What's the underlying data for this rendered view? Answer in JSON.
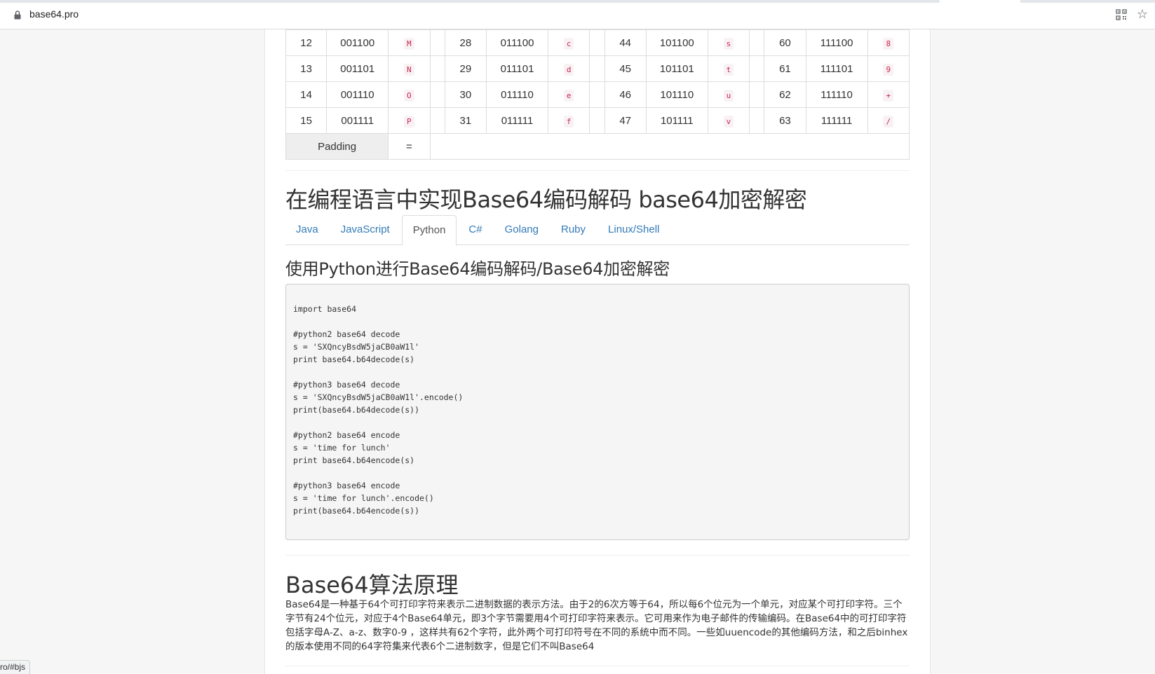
{
  "browser": {
    "url": "base64.pro",
    "status_url": "ro/#bjs"
  },
  "table": {
    "rows": [
      [
        [
          "12",
          "001100",
          "M"
        ],
        [
          "28",
          "011100",
          "c"
        ],
        [
          "44",
          "101100",
          "s"
        ],
        [
          "60",
          "111100",
          "8"
        ]
      ],
      [
        [
          "13",
          "001101",
          "N"
        ],
        [
          "29",
          "011101",
          "d"
        ],
        [
          "45",
          "101101",
          "t"
        ],
        [
          "61",
          "111101",
          "9"
        ]
      ],
      [
        [
          "14",
          "001110",
          "O"
        ],
        [
          "30",
          "011110",
          "e"
        ],
        [
          "46",
          "101110",
          "u"
        ],
        [
          "62",
          "111110",
          "+"
        ]
      ],
      [
        [
          "15",
          "001111",
          "P"
        ],
        [
          "31",
          "011111",
          "f"
        ],
        [
          "47",
          "101111",
          "v"
        ],
        [
          "63",
          "111111",
          "/"
        ]
      ]
    ],
    "padding_label": "Padding",
    "padding_value": "="
  },
  "main_heading": "在编程语言中实现Base64编码解码 base64加密解密",
  "tabs": [
    {
      "label": "Java",
      "active": false
    },
    {
      "label": "JavaScript",
      "active": false
    },
    {
      "label": "Python",
      "active": true
    },
    {
      "label": "C#",
      "active": false
    },
    {
      "label": "Golang",
      "active": false
    },
    {
      "label": "Ruby",
      "active": false
    },
    {
      "label": "Linux/Shell",
      "active": false
    }
  ],
  "sub_heading": "使用Python进行Base64编码解码/Base64加密解密",
  "code": "import base64\n\n#python2 base64 decode\ns = 'SXQncyBsdW5jaCB0aW1l'\nprint base64.b64decode(s)\n\n#python3 base64 decode\ns = 'SXQncyBsdW5jaCB0aW1l'.encode()\nprint(base64.b64decode(s))\n\n#python2 base64 encode\ns = 'time for lunch'\nprint base64.b64encode(s)\n\n#python3 base64 encode\ns = 'time for lunch'.encode()\nprint(base64.b64encode(s))",
  "algo_heading": "Base64算法原理",
  "algo_text": "Base64是一种基于64个可打印字符来表示二进制数据的表示方法。由于2的6次方等于64，所以每6个位元为一个单元，对应某个可打印字符。三个字节有24个位元，对应于4个Base64单元，即3个字节需要用4个可打印字符来表示。它可用来作为电子邮件的传输编码。在Base64中的可打印字符包括字母A-Z、a-z、数字0-9 ，这样共有62个字符，此外两个可打印符号在不同的系统中而不同。一些如uuencode的其他编码方法，和之后binhex的版本使用不同的64字符集来代表6个二进制数字，但是它们不叫Base64",
  "colors": {
    "link": "#337ab7",
    "code_red": "#c7254e",
    "code_bg": "#f9f2f4"
  }
}
